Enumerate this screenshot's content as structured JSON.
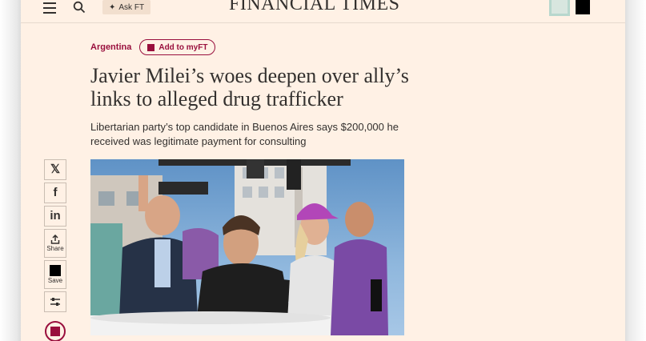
{
  "header": {
    "masthead": "FINANCIAL TIMES",
    "ask_label": "Ask FT",
    "colors": {
      "page_bg": "#fff1e5",
      "claret": "#990f3d",
      "ink": "#33302e"
    }
  },
  "article": {
    "topic": "Argentina",
    "myft_label": "Add to myFT",
    "headline": "Javier Milei’s woes deepen over ally’s links to alleged drug trafficker",
    "standfirst": "Libertarian party’s top candidate in Buenos Aires says $200,000 he received was legitimate payment for consulting"
  },
  "share": {
    "items": [
      {
        "icon": "x-icon",
        "glyph": "𝕏",
        "label": ""
      },
      {
        "icon": "facebook-icon",
        "glyph": "f",
        "label": ""
      },
      {
        "icon": "linkedin-icon",
        "glyph": "in",
        "label": ""
      },
      {
        "icon": "share-icon",
        "glyph": "⇪",
        "label": "Share"
      },
      {
        "icon": "save-icon",
        "glyph": "",
        "label": "Save"
      },
      {
        "icon": "settings-sliders-icon",
        "glyph": "",
        "label": ""
      }
    ]
  }
}
